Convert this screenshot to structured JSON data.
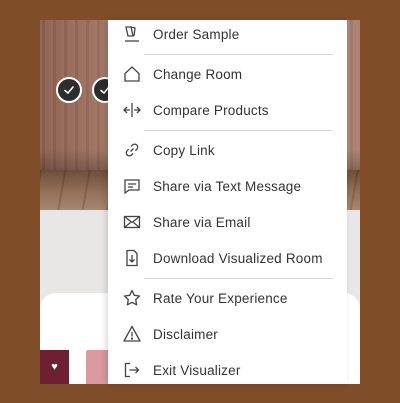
{
  "menu": {
    "items": [
      {
        "label": "Order Sample",
        "icon": "sample-swatch-icon"
      },
      {
        "label": "Change Room",
        "icon": "house-icon"
      },
      {
        "label": "Compare Products",
        "icon": "compare-arrows-icon"
      },
      {
        "label": "Copy Link",
        "icon": "link-icon"
      },
      {
        "label": "Share via Text Message",
        "icon": "chat-message-icon"
      },
      {
        "label": "Share via Email",
        "icon": "email-envelope-icon"
      },
      {
        "label": "Download Visualized Room",
        "icon": "download-icon"
      },
      {
        "label": "Rate Your Experience",
        "icon": "star-icon"
      },
      {
        "label": "Disclaimer",
        "icon": "warning-triangle-icon"
      },
      {
        "label": "Exit Visualizer",
        "icon": "exit-icon"
      }
    ]
  },
  "background": {
    "swatch_badge": "♥"
  },
  "colors": {
    "backdrop": "#7f4e28",
    "menu_text": "#333333",
    "swatch_primary": "#6d2130",
    "swatch_secondary": "#d99aa0"
  }
}
